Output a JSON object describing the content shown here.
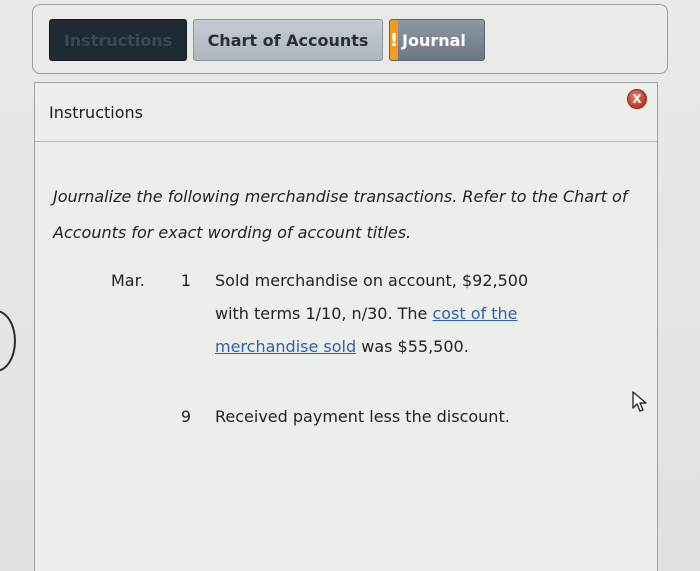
{
  "tabs": [
    {
      "label": "Instructions",
      "active": true
    },
    {
      "label": "Chart of Accounts",
      "active": false
    },
    {
      "label": "Journal",
      "active": false,
      "alert": "!"
    }
  ],
  "panel": {
    "title": "Instructions",
    "close_label": "X",
    "intro": "Journalize the following merchandise transactions. Refer to the Chart of Accounts for exact wording of account titles.",
    "transactions": [
      {
        "month": "Mar.",
        "day": "1",
        "text_before": "Sold merchandise on account, $92,500 with terms 1/10, n/30. The",
        "link": "cost of the merchandise sold",
        "text_after": "was $55,500."
      },
      {
        "month": "",
        "day": "9",
        "text_before": "Received payment less the discount.",
        "link": "",
        "text_after": ""
      }
    ]
  },
  "colors": {
    "active_tab": "#1f2a33",
    "alert": "#f39a1b",
    "close": "#c0392b",
    "link": "#2f5fb3"
  }
}
